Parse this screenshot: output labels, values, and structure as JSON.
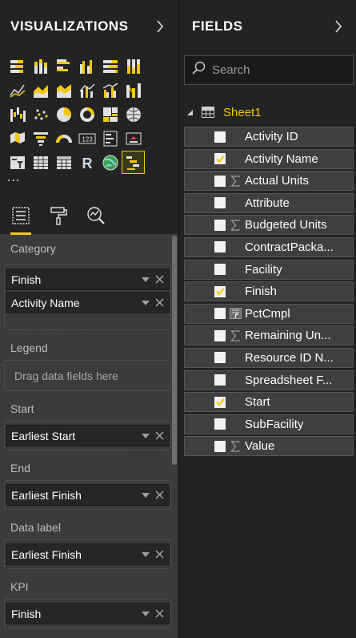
{
  "visualizations": {
    "title": "VISUALIZATIONS",
    "more": "...",
    "icons": [
      "stacked-bar-icon",
      "stacked-column-icon",
      "clustered-bar-icon",
      "clustered-column-icon",
      "percent-bar-icon",
      "percent-column-icon",
      "blank-1",
      "line-chart-icon",
      "area-chart-icon",
      "stacked-area-icon",
      "line-column-icon",
      "line-clustered-column-icon",
      "ribbon-chart-icon",
      "blank-2",
      "waterfall-icon",
      "scatter-icon",
      "pie-chart-icon",
      "donut-chart-icon",
      "treemap-icon",
      "map-icon",
      "blank-3",
      "filled-map-icon",
      "funnel-icon",
      "gauge-icon",
      "card-icon",
      "multirow-card-icon",
      "kpi-icon",
      "blank-4",
      "slicer-icon",
      "table-icon",
      "matrix-icon",
      "r-visual-icon",
      "globe-icon",
      "gantt-icon",
      "blank-5"
    ],
    "card_text": "123",
    "r_text": "R",
    "wells": {
      "category": {
        "label": "Category",
        "fields": [
          "Finish",
          "Activity Name"
        ]
      },
      "legend": {
        "label": "Legend",
        "placeholder": "Drag data fields here"
      },
      "start": {
        "label": "Start",
        "fields": [
          "Earliest Start"
        ]
      },
      "end": {
        "label": "End",
        "fields": [
          "Earliest Finish"
        ]
      },
      "data_label": {
        "label": "Data label",
        "fields": [
          "Earliest Finish"
        ]
      },
      "kpi": {
        "label": "KPI",
        "fields": [
          "Finish"
        ]
      }
    }
  },
  "fields": {
    "title": "FIELDS",
    "search_placeholder": "Search",
    "table": "Sheet1",
    "items": [
      {
        "name": "Activity ID",
        "checked": false,
        "sigma": false
      },
      {
        "name": "Activity Name",
        "checked": true,
        "sigma": false
      },
      {
        "name": "Actual Units",
        "checked": false,
        "sigma": true
      },
      {
        "name": "Attribute",
        "checked": false,
        "sigma": false
      },
      {
        "name": "Budgeted Units",
        "checked": false,
        "sigma": true
      },
      {
        "name": "ContractPacka...",
        "checked": false,
        "sigma": false
      },
      {
        "name": "Facility",
        "checked": false,
        "sigma": false
      },
      {
        "name": "Finish",
        "checked": true,
        "sigma": false
      },
      {
        "name": "PctCmpl",
        "checked": false,
        "sigma": false,
        "calc": true
      },
      {
        "name": "Remaining Un...",
        "checked": false,
        "sigma": true
      },
      {
        "name": "Resource ID N...",
        "checked": false,
        "sigma": false
      },
      {
        "name": "Spreadsheet F...",
        "checked": false,
        "sigma": false
      },
      {
        "name": "Start",
        "checked": true,
        "sigma": false
      },
      {
        "name": "SubFacility",
        "checked": false,
        "sigma": false
      },
      {
        "name": "Value",
        "checked": false,
        "sigma": true
      }
    ]
  },
  "colors": {
    "accent": "#f2c80f",
    "pane_bg": "#3b3b3b",
    "header_bg": "#232323"
  }
}
